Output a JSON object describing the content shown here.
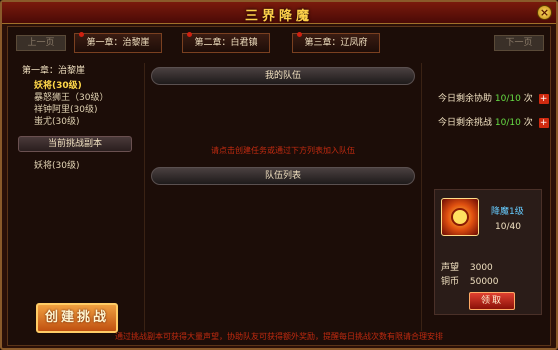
{
  "window": {
    "title": "三界降魔"
  },
  "nav": {
    "prev_label": "上一页",
    "next_label": "下一页",
    "tabs": [
      {
        "label": "第一章：治黎崖"
      },
      {
        "label": "第二章：白君镇"
      },
      {
        "label": "第三章：辽凤府"
      }
    ]
  },
  "left": {
    "chapter_title": "第一章：治黎崖",
    "bosses": [
      {
        "label": "妖将(30级)"
      },
      {
        "label": "暴怒狮王（30级）"
      },
      {
        "label": "祥钟阿里(30级)"
      },
      {
        "label": "蚩尤(30级)"
      }
    ],
    "current_section_label": "当前挑战副本",
    "current_boss": "妖将(30级)",
    "create_button_label": "创建挑战"
  },
  "middle": {
    "my_team_header": "我的队伍",
    "my_team_message": "请点击创建任务或通过下方列表加入队伍",
    "team_list_header": "队伍列表"
  },
  "right": {
    "assist": {
      "label": "今日剩余协助",
      "value": "10/10",
      "unit": "次"
    },
    "challenge": {
      "label": "今日剩余挑战",
      "value": "10/10",
      "unit": "次"
    },
    "reward": {
      "name": "降魔1级",
      "progress": "10/40",
      "fame_label": "声望",
      "fame_value": "3000",
      "coin_label": "铜币",
      "coin_value": "50000",
      "claim_label": "领取"
    }
  },
  "footer": {
    "message": "通过挑战副本可获得大量声望，协助队友可获得额外奖励，提醒每日挑战次数有限请合理安排"
  }
}
